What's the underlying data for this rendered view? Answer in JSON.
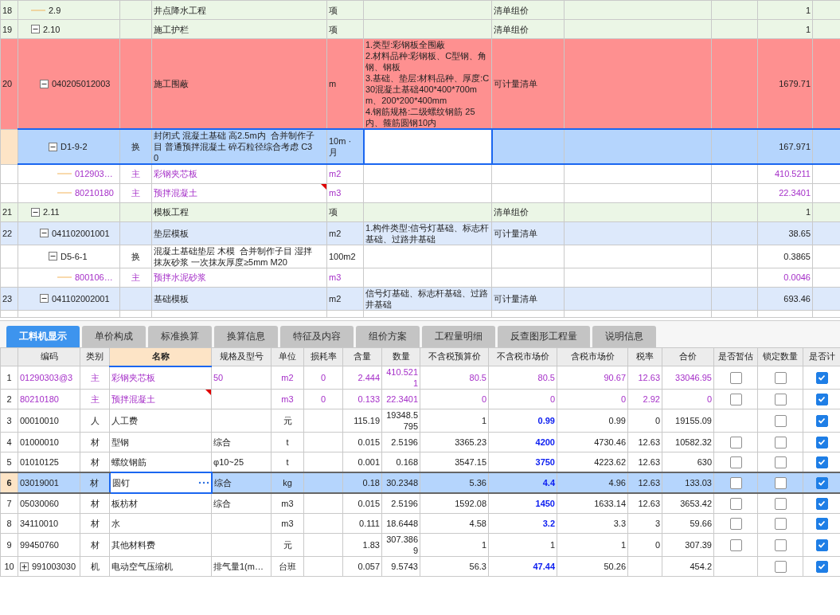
{
  "bill_table": {
    "rows": [
      {
        "num": "18",
        "code": "2.9",
        "name": "井点降水工程",
        "unit": "项",
        "category": "清单组价",
        "value": "1",
        "kind": "group",
        "selected": false,
        "flagged": false,
        "note": false
      },
      {
        "num": "19",
        "code": "2.10",
        "name": "施工护栏",
        "unit": "项",
        "category": "清单组价",
        "value": "1",
        "kind": "group",
        "selected": false,
        "flagged": false,
        "note": false,
        "expanded": true,
        "children": [
          {
            "num": "20",
            "code": "040205012003",
            "name": "施工围蔽",
            "unit": "m",
            "features": "1.类型:彩钢板全围蔽\n2.材料品种:彩钢板、C型钢、角钢、钢板\n3.基础、垫层:材料品种、厚度:C30混凝土基础400*400*700mm、200*200*400mm\n4.钢筋规格:二级螺纹钢筋 25内、箍筋圆钢10内",
            "category": "可计量清单",
            "value": "1679.71",
            "kind": "bill",
            "selected": false,
            "flagged": true,
            "note": false,
            "expanded": true,
            "children": [
              {
                "code": "D1-9-2",
                "type": "换",
                "name": "封闭式 混凝土基础 高2.5m内  合并制作子目 普通预拌混凝土 碎石粒径综合考虑 C30",
                "unit": "10m · 月",
                "value": "167.971",
                "kind": "quota",
                "selected": true,
                "flagged": false,
                "note": false,
                "expanded": true,
                "children": [
                  {
                    "code": "012903…",
                    "type": "主",
                    "name": "彩钢夹芯板",
                    "unit": "m2",
                    "value": "410.5211",
                    "kind": "material",
                    "selected": false,
                    "flagged": false,
                    "note": false
                  },
                  {
                    "code": "80210180",
                    "type": "主",
                    "name": "预拌混凝土",
                    "unit": "m3",
                    "value": "22.3401",
                    "kind": "material",
                    "selected": false,
                    "flagged": false,
                    "note": true
                  }
                ]
              }
            ]
          }
        ]
      },
      {
        "num": "21",
        "code": "2.11",
        "name": "模板工程",
        "unit": "项",
        "category": "清单组价",
        "value": "1",
        "kind": "group",
        "selected": false,
        "flagged": false,
        "note": false,
        "expanded": true,
        "children": [
          {
            "num": "22",
            "code": "041102001001",
            "name": "垫层模板",
            "unit": "m2",
            "features": "1.构件类型:信号灯基础、标志杆基础、过路井基础",
            "category": "可计量清单",
            "value": "38.65",
            "kind": "bill",
            "selected": false,
            "flagged": false,
            "note": false,
            "expanded": true,
            "children": [
              {
                "code": "D5-6-1",
                "type": "换",
                "name": "混凝土基础垫层 木模  合并制作子目 湿拌抹灰砂浆 一次抹灰厚度≥5mm M20",
                "unit": "100m2",
                "value": "0.3865",
                "kind": "quota",
                "selected": false,
                "flagged": false,
                "note": false,
                "expanded": true,
                "children": [
                  {
                    "code": "800106…",
                    "type": "主",
                    "name": "预拌水泥砂浆",
                    "unit": "m3",
                    "value": "0.0046",
                    "kind": "material",
                    "selected": false,
                    "flagged": false,
                    "note": false
                  }
                ]
              }
            ]
          },
          {
            "num": "23",
            "code": "041102002001",
            "name": "基础模板",
            "unit": "m2",
            "features": "信号灯基础、标志杆基础、过路井基础",
            "category": "可计量清单",
            "value": "693.46",
            "kind": "bill",
            "selected": false,
            "flagged": false,
            "note": false,
            "expanded": true
          }
        ]
      }
    ]
  },
  "detail_tabs": [
    {
      "label": "工料机显示",
      "selected": true
    },
    {
      "label": "单价构成",
      "selected": false
    },
    {
      "label": "标准换算",
      "selected": false
    },
    {
      "label": "换算信息",
      "selected": false
    },
    {
      "label": "特征及内容",
      "selected": false
    },
    {
      "label": "组价方案",
      "selected": false
    },
    {
      "label": "工程量明细",
      "selected": false
    },
    {
      "label": "反查图形工程量",
      "selected": false
    },
    {
      "label": "说明信息",
      "selected": false
    }
  ],
  "resource_table": {
    "columns": [
      {
        "label": "编码",
        "selected": false
      },
      {
        "label": "类别",
        "selected": false
      },
      {
        "label": "名称",
        "selected": true
      },
      {
        "label": "规格及型号",
        "selected": false
      },
      {
        "label": "单位",
        "selected": false
      },
      {
        "label": "损耗率",
        "selected": false
      },
      {
        "label": "含量",
        "selected": false
      },
      {
        "label": "数量",
        "selected": false
      },
      {
        "label": "不含税预算价",
        "selected": false
      },
      {
        "label": "不含税市场价",
        "selected": false
      },
      {
        "label": "含税市场价",
        "selected": false
      },
      {
        "label": "税率",
        "selected": false
      },
      {
        "label": "合价",
        "selected": false
      },
      {
        "label": "是否暂估",
        "selected": false
      },
      {
        "label": "锁定数量",
        "selected": false
      },
      {
        "label": "是否计",
        "selected": false
      }
    ],
    "rows": [
      {
        "num": "1",
        "code": "01290303@3",
        "type": "主",
        "name": "彩钢夹芯板",
        "spec": "50",
        "unit": "m2",
        "loss": "0",
        "content": "2.444",
        "qty": "410.5211",
        "budget": "80.5",
        "market": "80.5",
        "market_tax": "90.67",
        "tax": "12.63",
        "total": "33046.95",
        "estimate": false,
        "locked": false,
        "counted": true,
        "kind": "main",
        "price_changed": false,
        "selected": false,
        "note": false
      },
      {
        "num": "2",
        "code": "80210180",
        "type": "主",
        "name": "预拌混凝土",
        "unit": "m3",
        "loss": "0",
        "content": "0.133",
        "qty": "22.3401",
        "budget": "0",
        "market": "0",
        "market_tax": "0",
        "tax": "2.92",
        "total": "0",
        "estimate": false,
        "locked": false,
        "counted": true,
        "kind": "main",
        "price_changed": false,
        "selected": false,
        "note": true
      },
      {
        "num": "3",
        "code": "00010010",
        "type": "人",
        "name": "人工费",
        "unit": "元",
        "content": "115.19",
        "qty": "19348.5795",
        "budget": "1",
        "market": "0.99",
        "market_tax": "0.99",
        "tax": "0",
        "total": "19155.09",
        "locked": false,
        "counted": true,
        "kind": "normal",
        "price_changed": true,
        "selected": false,
        "note": false
      },
      {
        "num": "4",
        "code": "01000010",
        "type": "材",
        "name": "型钢",
        "spec": "综合",
        "unit": "t",
        "content": "0.015",
        "qty": "2.5196",
        "budget": "3365.23",
        "market": "4200",
        "market_tax": "4730.46",
        "tax": "12.63",
        "total": "10582.32",
        "estimate": false,
        "locked": false,
        "counted": true,
        "kind": "normal",
        "price_changed": true,
        "selected": false,
        "note": false
      },
      {
        "num": "5",
        "code": "01010125",
        "type": "材",
        "name": "螺纹钢筋",
        "spec": "φ10~25",
        "unit": "t",
        "content": "0.001",
        "qty": "0.168",
        "budget": "3547.15",
        "market": "3750",
        "market_tax": "4223.62",
        "tax": "12.63",
        "total": "630",
        "estimate": false,
        "locked": false,
        "counted": true,
        "kind": "normal",
        "price_changed": true,
        "selected": false,
        "note": false
      },
      {
        "num": "6",
        "code": "03019001",
        "type": "材",
        "name": "圆钉",
        "spec": "综合",
        "unit": "kg",
        "content": "0.18",
        "qty": "30.2348",
        "budget": "5.36",
        "market": "4.4",
        "market_tax": "4.96",
        "tax": "12.63",
        "total": "133.03",
        "estimate": false,
        "locked": false,
        "counted": true,
        "kind": "normal",
        "price_changed": true,
        "selected": true,
        "note": false
      },
      {
        "num": "7",
        "code": "05030060",
        "type": "材",
        "name": "板枋材",
        "spec": "综合",
        "unit": "m3",
        "content": "0.015",
        "qty": "2.5196",
        "budget": "1592.08",
        "market": "1450",
        "market_tax": "1633.14",
        "tax": "12.63",
        "total": "3653.42",
        "estimate": false,
        "locked": false,
        "counted": true,
        "kind": "normal",
        "price_changed": true,
        "selected": false,
        "note": false
      },
      {
        "num": "8",
        "code": "34110010",
        "type": "材",
        "name": "水",
        "unit": "m3",
        "content": "0.111",
        "qty": "18.6448",
        "budget": "4.58",
        "market": "3.2",
        "market_tax": "3.3",
        "tax": "3",
        "total": "59.66",
        "estimate": false,
        "locked": false,
        "counted": true,
        "kind": "normal",
        "price_changed": true,
        "selected": false,
        "note": false
      },
      {
        "num": "9",
        "code": "99450760",
        "type": "材",
        "name": "其他材料费",
        "unit": "元",
        "content": "1.83",
        "qty": "307.3869",
        "budget": "1",
        "market": "1",
        "market_tax": "1",
        "tax": "0",
        "total": "307.39",
        "estimate": false,
        "locked": false,
        "counted": true,
        "kind": "normal",
        "price_changed": false,
        "selected": false,
        "note": false
      },
      {
        "num": "10",
        "code": "991003030",
        "type": "机",
        "name": "电动空气压缩机",
        "spec": "排气量1(m…",
        "unit": "台班",
        "content": "0.057",
        "qty": "9.5743",
        "budget": "56.3",
        "market": "47.44",
        "market_tax": "50.26",
        "total": "454.2",
        "locked": false,
        "counted": true,
        "kind": "normal",
        "price_changed": true,
        "selected": false,
        "note": false,
        "expanded": false
      }
    ]
  }
}
